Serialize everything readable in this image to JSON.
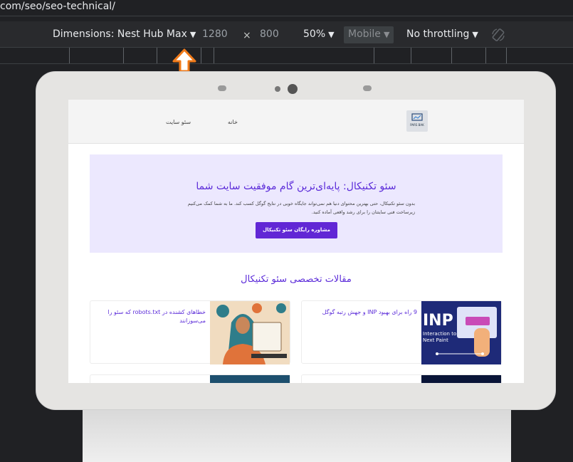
{
  "browser": {
    "url_fragment": "com/seo/seo-technical/",
    "device_label": "Dimensions: Nest Hub Max",
    "width": "1280",
    "times": "×",
    "height": "800",
    "zoom": "50%",
    "mobile_label": "Mobile",
    "throttle_label": "No throttling"
  },
  "site": {
    "logo_text": "PARS BAK",
    "nav": {
      "home": "خانه",
      "seo": "سئو سایت"
    },
    "hero": {
      "title": "سئو تکنیکال: پایه‌ای‌ترین گام موفقیت سایت شما",
      "description": "بدون سئو تکنیکال، حتی بهترین محتوای دنیا هم نمی‌تواند جایگاه خوبی در نتایج گوگل کسب کند. ما به شما کمک می‌کنیم زیرساخت فنی سایتتان را برای رشد واقعی آماده کنید.",
      "cta": "مشاوره رایگان سئو تکنیکال"
    },
    "section_title": "مقالات تخصصی سئو تکنیکال",
    "articles": [
      {
        "title": "9 راه برای بهبود INP و جهش رتبه گوگل"
      },
      {
        "title": "خطاهای کشنده در robots.txt که سئو را می‌سوزانند"
      }
    ]
  }
}
